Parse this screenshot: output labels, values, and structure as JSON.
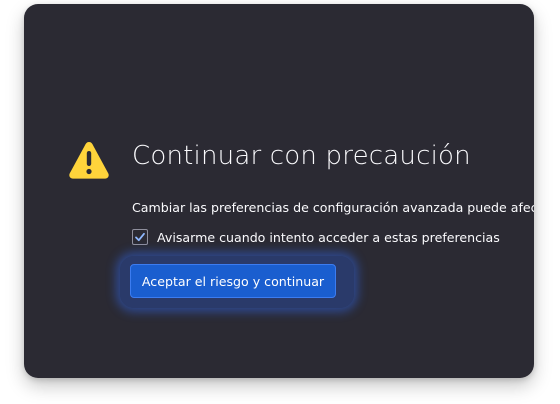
{
  "dialog": {
    "title": "Continuar con precaución",
    "description": "Cambiar las preferencias de configuración avanzada puede afectar el r",
    "checkbox": {
      "label": "Avisarme cuando intento acceder a estas preferencias",
      "checked": true
    },
    "accept_button_label": "Aceptar el riesgo y continuar",
    "warning_icon": "warning-triangle-icon"
  },
  "colors": {
    "background": "#2b2a33",
    "text": "#fbfbfe",
    "accent": "#1a5ecf",
    "warning": "#ffd43b"
  }
}
